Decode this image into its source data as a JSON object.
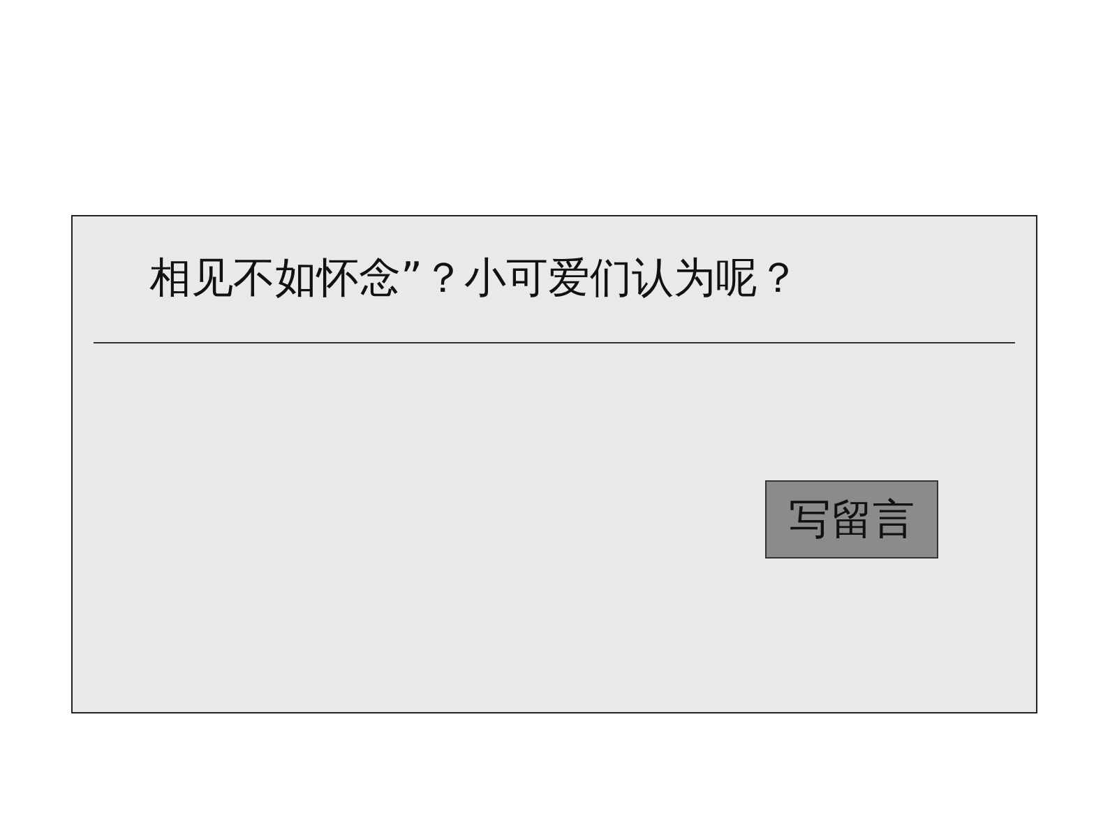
{
  "dialog": {
    "message": "相见不如怀念”？小可爱们认为呢？",
    "button": "写留言"
  }
}
